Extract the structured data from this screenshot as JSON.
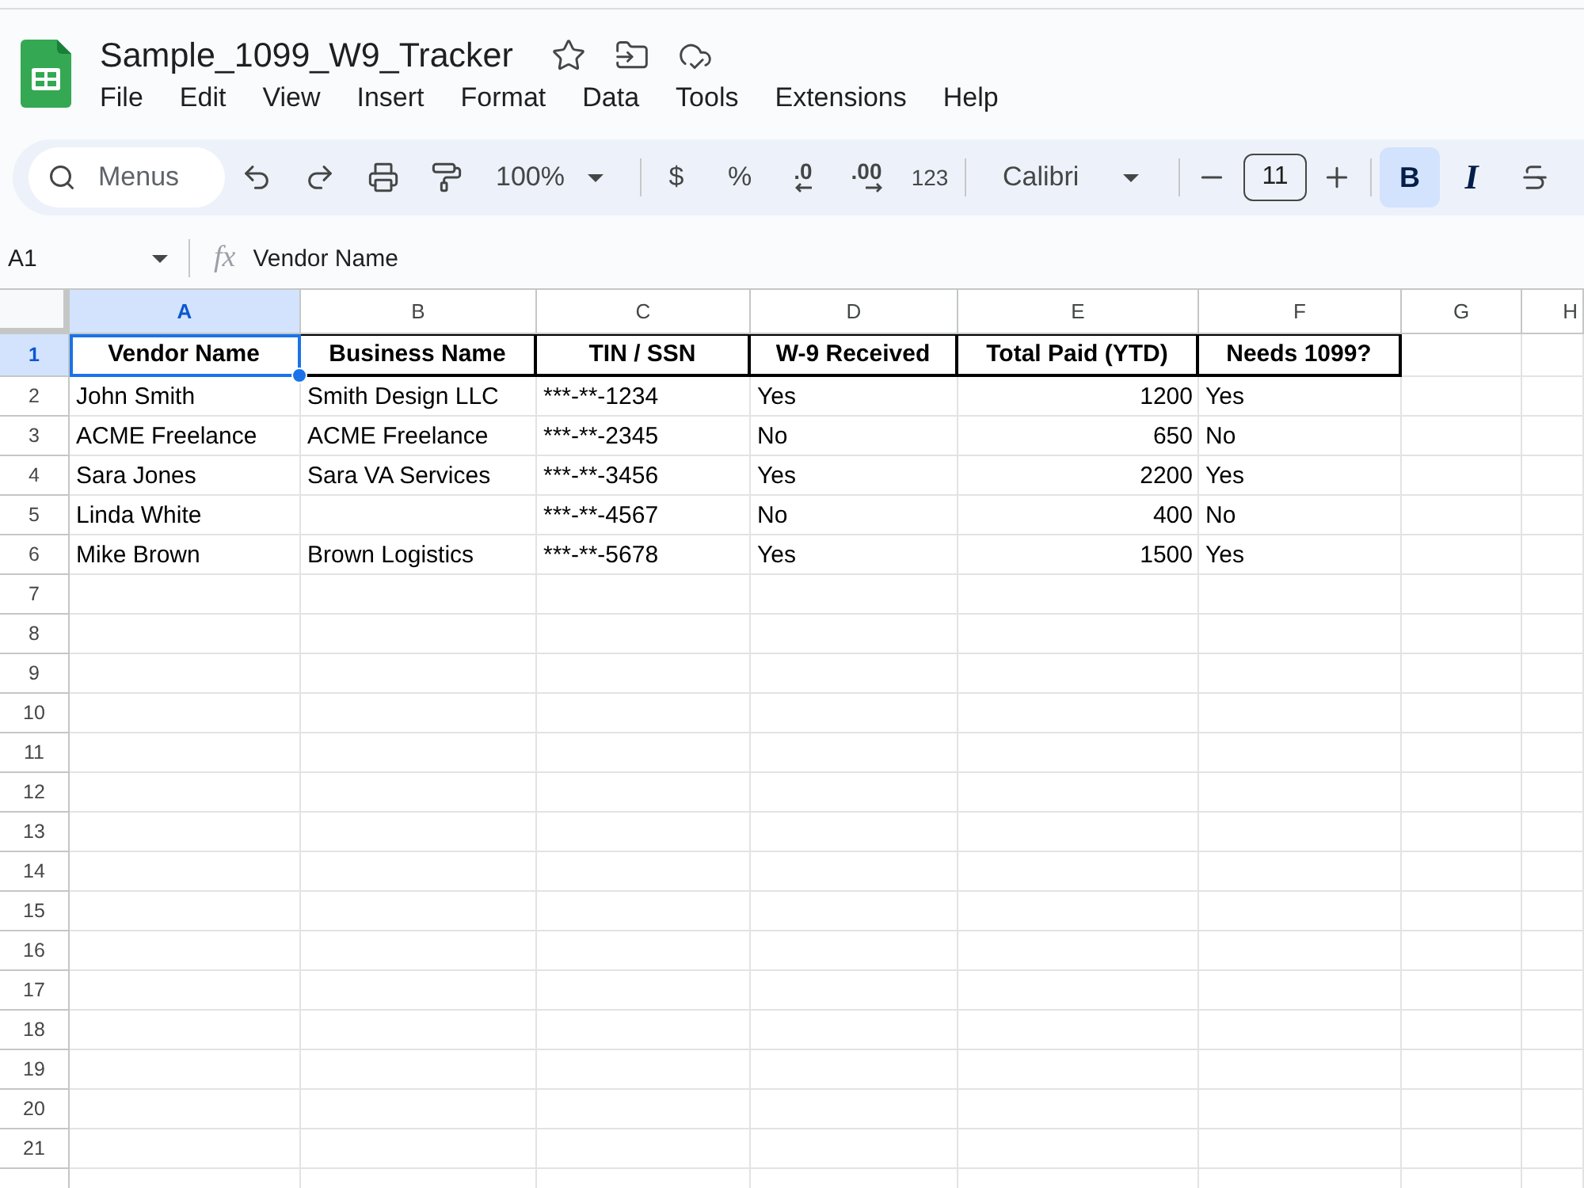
{
  "document": {
    "title": "Sample_1099_W9_Tracker",
    "starred": false
  },
  "menu": [
    "File",
    "Edit",
    "View",
    "Insert",
    "Format",
    "Data",
    "Tools",
    "Extensions",
    "Help"
  ],
  "toolbar": {
    "search": {
      "placeholder": "Menus"
    },
    "zoom": "100%",
    "number_formats": [
      {
        "kind": "currency",
        "label": "$"
      },
      {
        "kind": "percent",
        "label": "%"
      },
      {
        "kind": "decrease_decimal",
        "label": ".0"
      },
      {
        "kind": "increase_decimal",
        "label": ".00"
      },
      {
        "kind": "number_format",
        "label": "123"
      }
    ],
    "font": "Calibri",
    "font_size": "11",
    "styles": [
      {
        "kind": "bold",
        "label": "B",
        "on": true
      },
      {
        "kind": "italic",
        "label": "I",
        "on": false
      },
      {
        "kind": "strikethrough",
        "on": false
      }
    ]
  },
  "formula_bar": {
    "cell_ref": "A1",
    "fx": "fx",
    "content": "Vendor Name"
  },
  "sheet": {
    "columns": [
      {
        "label": "A",
        "kind": "text",
        "selected": true
      },
      {
        "label": "B",
        "kind": "text",
        "selected": false
      },
      {
        "label": "C",
        "kind": "text",
        "selected": false
      },
      {
        "label": "D",
        "kind": "text",
        "selected": false
      },
      {
        "label": "E",
        "kind": "number",
        "selected": false
      },
      {
        "label": "F",
        "kind": "text",
        "selected": false
      },
      {
        "label": "G",
        "selected": false
      },
      {
        "label": "H",
        "selected": false
      }
    ],
    "rows": [
      {
        "label": "1",
        "kind": "header",
        "selected": true,
        "cells": [
          "Vendor Name",
          "Business Name",
          "TIN / SSN",
          "W-9 Received",
          "Total Paid (YTD)",
          "Needs 1099?"
        ]
      },
      {
        "label": "2",
        "kind": "data",
        "selected": false,
        "cells": [
          "John Smith",
          "Smith Design LLC",
          "***-**-1234",
          "Yes",
          "1200",
          "Yes"
        ]
      },
      {
        "label": "3",
        "kind": "data",
        "selected": false,
        "cells": [
          "ACME Freelance",
          "ACME Freelance",
          "***-**-2345",
          "No",
          "650",
          "No"
        ]
      },
      {
        "label": "4",
        "kind": "data",
        "selected": false,
        "cells": [
          "Sara Jones",
          "Sara VA Services",
          "***-**-3456",
          "Yes",
          "2200",
          "Yes"
        ]
      },
      {
        "label": "5",
        "kind": "data",
        "selected": false,
        "cells": [
          "Linda White",
          null,
          "***-**-4567",
          "No",
          "400",
          "No"
        ]
      },
      {
        "label": "6",
        "kind": "data",
        "selected": false,
        "cells": [
          "Mike Brown",
          "Brown Logistics",
          "***-**-5678",
          "Yes",
          "1500",
          "Yes"
        ]
      },
      {
        "label": "7",
        "kind": "data",
        "selected": false
      },
      {
        "label": "8",
        "kind": "data",
        "selected": false
      },
      {
        "label": "9",
        "kind": "data",
        "selected": false
      },
      {
        "label": "10",
        "kind": "data",
        "selected": false
      },
      {
        "label": "11",
        "kind": "data",
        "selected": false
      },
      {
        "label": "12",
        "kind": "data",
        "selected": false
      },
      {
        "label": "13",
        "kind": "data",
        "selected": false
      },
      {
        "label": "14",
        "kind": "data",
        "selected": false
      },
      {
        "label": "15",
        "kind": "data",
        "selected": false
      },
      {
        "label": "16",
        "kind": "data",
        "selected": false
      },
      {
        "label": "17",
        "kind": "data",
        "selected": false
      },
      {
        "label": "18",
        "kind": "data",
        "selected": false
      },
      {
        "label": "19",
        "kind": "data",
        "selected": false
      },
      {
        "label": "20",
        "kind": "data",
        "selected": false
      },
      {
        "label": "21",
        "kind": "data",
        "selected": false
      }
    ]
  }
}
